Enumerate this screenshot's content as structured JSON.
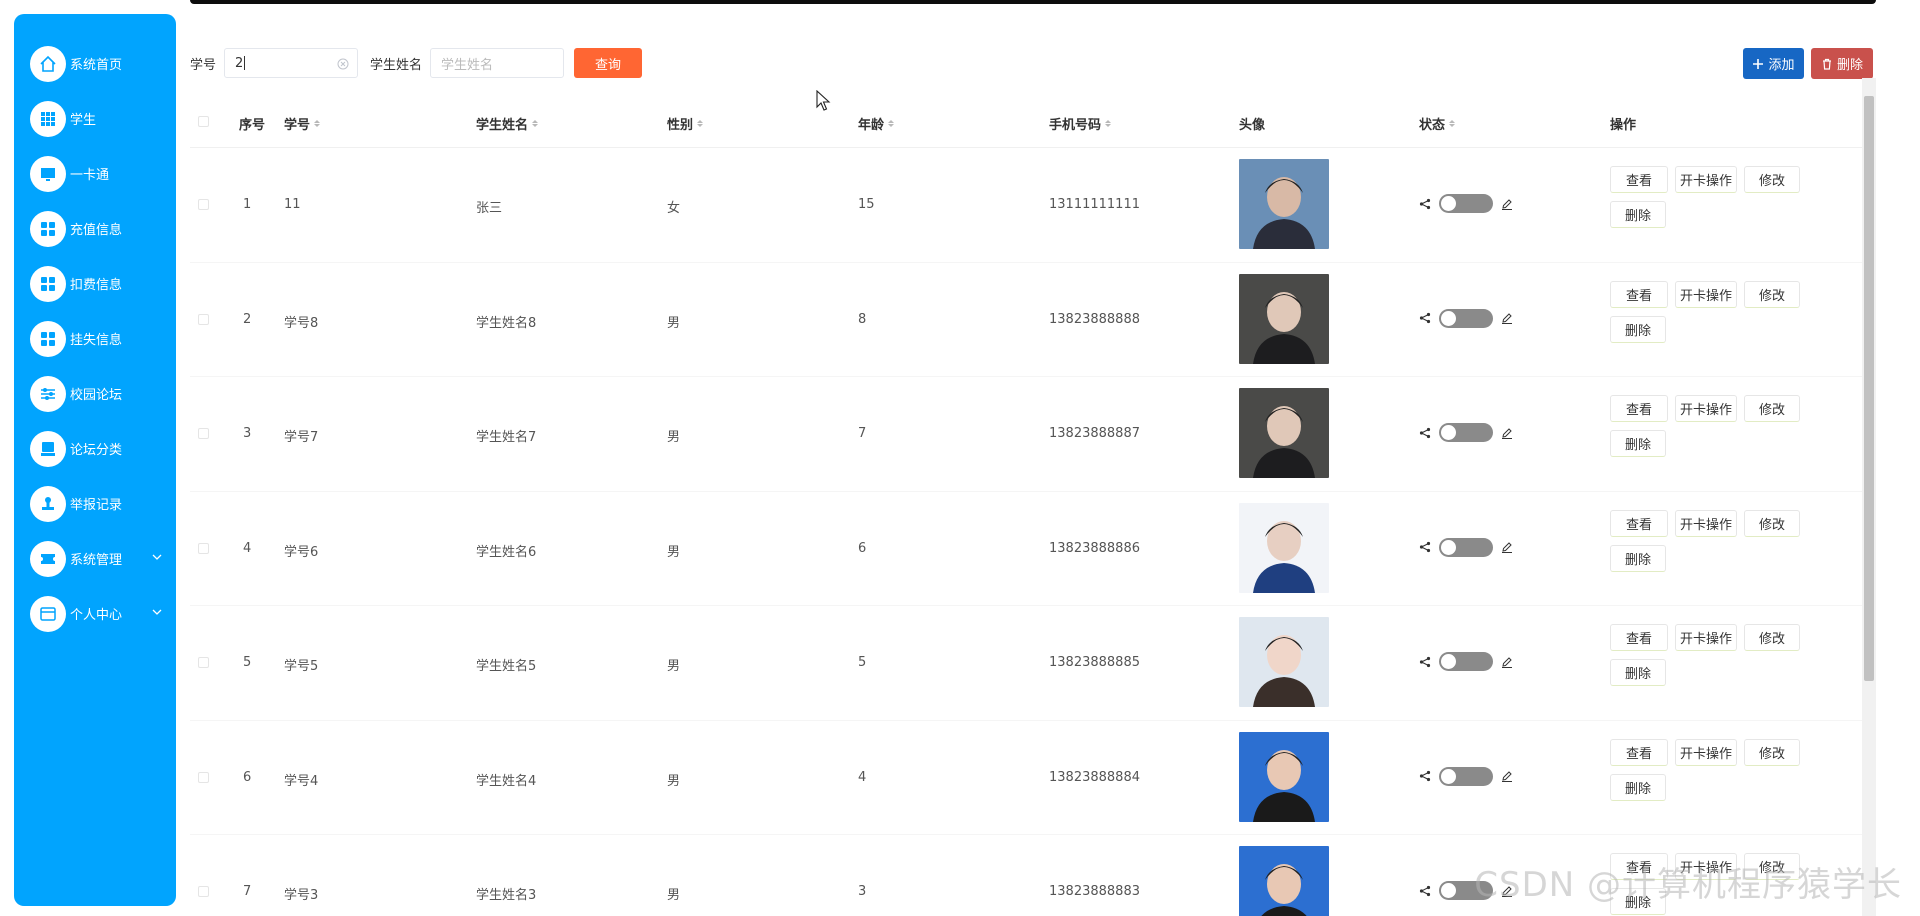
{
  "colors": {
    "sidebar_bg": "#01a4fe",
    "query_button": "#ff6633",
    "add_button": "#1767c4",
    "delete_button": "#c9514c",
    "toggle_off": "#8a8a8a"
  },
  "sidebar": {
    "items": [
      {
        "label": "系统首页",
        "icon": "home-icon"
      },
      {
        "label": "学生",
        "icon": "grid-icon"
      },
      {
        "label": "一卡通",
        "icon": "monitor-icon"
      },
      {
        "label": "充值信息",
        "icon": "apps-icon"
      },
      {
        "label": "扣费信息",
        "icon": "apps-icon"
      },
      {
        "label": "挂失信息",
        "icon": "apps-icon"
      },
      {
        "label": "校园论坛",
        "icon": "sliders-icon"
      },
      {
        "label": "论坛分类",
        "icon": "screen-icon"
      },
      {
        "label": "举报记录",
        "icon": "stamp-icon"
      },
      {
        "label": "系统管理",
        "icon": "ticket-icon",
        "expandable": true
      },
      {
        "label": "个人中心",
        "icon": "card-icon",
        "expandable": true
      }
    ]
  },
  "search": {
    "id_label": "学号",
    "id_value": "2",
    "name_label": "学生姓名",
    "name_placeholder": "学生姓名",
    "query_label": "查询"
  },
  "toolbar": {
    "add_label": "添加",
    "delete_label": "删除"
  },
  "table": {
    "headers": {
      "index": "序号",
      "student_id": "学号",
      "student_name": "学生姓名",
      "gender": "性别",
      "age": "年龄",
      "phone": "手机号码",
      "avatar": "头像",
      "status": "状态",
      "actions": "操作"
    },
    "actions": {
      "view": "查看",
      "card": "开卡操作",
      "edit": "修改",
      "delete": "删除"
    },
    "rows": [
      {
        "index": "1",
        "student_id": "11",
        "student_name": "张三",
        "gender": "女",
        "age": "15",
        "phone": "13111111111",
        "status_on": false
      },
      {
        "index": "2",
        "student_id": "学号8",
        "student_name": "学生姓名8",
        "gender": "男",
        "age": "8",
        "phone": "13823888888",
        "status_on": false
      },
      {
        "index": "3",
        "student_id": "学号7",
        "student_name": "学生姓名7",
        "gender": "男",
        "age": "7",
        "phone": "13823888887",
        "status_on": false
      },
      {
        "index": "4",
        "student_id": "学号6",
        "student_name": "学生姓名6",
        "gender": "男",
        "age": "6",
        "phone": "13823888886",
        "status_on": false
      },
      {
        "index": "5",
        "student_id": "学号5",
        "student_name": "学生姓名5",
        "gender": "男",
        "age": "5",
        "phone": "13823888885",
        "status_on": false
      },
      {
        "index": "6",
        "student_id": "学号4",
        "student_name": "学生姓名4",
        "gender": "男",
        "age": "4",
        "phone": "13823888884",
        "status_on": false
      },
      {
        "index": "7",
        "student_id": "学号3",
        "student_name": "学生姓名3",
        "gender": "男",
        "age": "3",
        "phone": "13823888883",
        "status_on": false
      }
    ]
  },
  "watermark": "CSDN @计算机程序猿学长"
}
